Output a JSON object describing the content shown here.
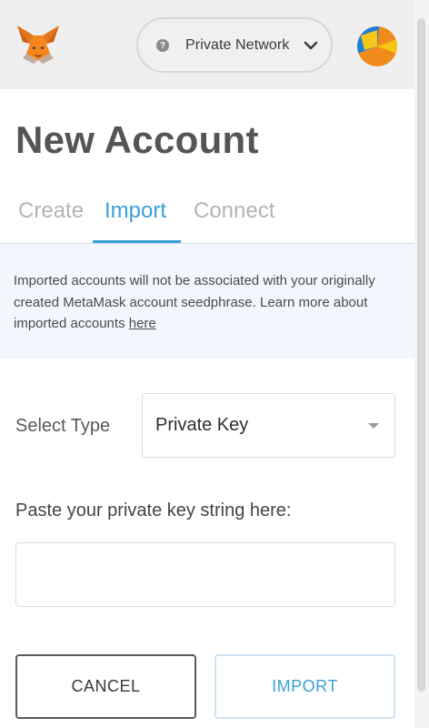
{
  "header": {
    "network_label": "Private Network",
    "network_help_icon": "question-circle-icon",
    "network_chevron_icon": "chevron-down-icon",
    "logo_icon": "metamask-fox-logo",
    "avatar_icon": "identicon-avatar"
  },
  "page": {
    "title": "New Account"
  },
  "tabs": [
    {
      "label": "Create",
      "active": false
    },
    {
      "label": "Import",
      "active": true
    },
    {
      "label": "Connect",
      "active": false
    }
  ],
  "notice": {
    "text": "Imported accounts will not be associated with your originally created MetaMask account seedphrase. Learn more about imported accounts ",
    "link_label": "here"
  },
  "form": {
    "select_type_label": "Select Type",
    "select_type_value": "Private Key",
    "select_type_options": [
      "Private Key"
    ],
    "key_label": "Paste your private key string here:",
    "key_value": "",
    "key_placeholder": ""
  },
  "actions": {
    "cancel_label": "CANCEL",
    "import_label": "IMPORT"
  },
  "colors": {
    "accent": "#3aa0d8",
    "header_bg": "#efefef",
    "notice_bg": "#f1f7fc",
    "fox_orange": "#e2761b",
    "avatar_blue": "#1e7fd6",
    "avatar_yellow": "#f5c518",
    "avatar_orange": "#f08a1c"
  }
}
